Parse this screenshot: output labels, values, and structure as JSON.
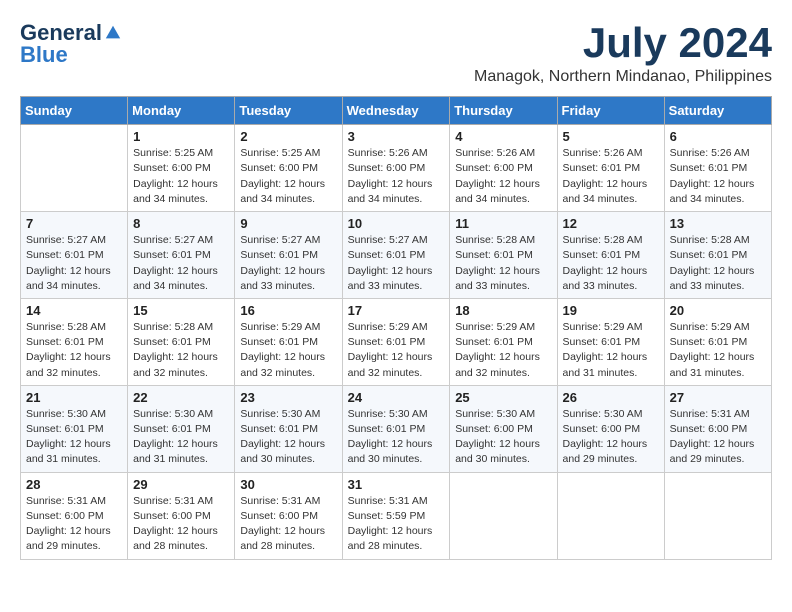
{
  "header": {
    "logo_general": "General",
    "logo_blue": "Blue",
    "month_year": "July 2024",
    "location": "Managok, Northern Mindanao, Philippines"
  },
  "days_of_week": [
    "Sunday",
    "Monday",
    "Tuesday",
    "Wednesday",
    "Thursday",
    "Friday",
    "Saturday"
  ],
  "weeks": [
    [
      {
        "day": "",
        "info": ""
      },
      {
        "day": "1",
        "info": "Sunrise: 5:25 AM\nSunset: 6:00 PM\nDaylight: 12 hours\nand 34 minutes."
      },
      {
        "day": "2",
        "info": "Sunrise: 5:25 AM\nSunset: 6:00 PM\nDaylight: 12 hours\nand 34 minutes."
      },
      {
        "day": "3",
        "info": "Sunrise: 5:26 AM\nSunset: 6:00 PM\nDaylight: 12 hours\nand 34 minutes."
      },
      {
        "day": "4",
        "info": "Sunrise: 5:26 AM\nSunset: 6:00 PM\nDaylight: 12 hours\nand 34 minutes."
      },
      {
        "day": "5",
        "info": "Sunrise: 5:26 AM\nSunset: 6:01 PM\nDaylight: 12 hours\nand 34 minutes."
      },
      {
        "day": "6",
        "info": "Sunrise: 5:26 AM\nSunset: 6:01 PM\nDaylight: 12 hours\nand 34 minutes."
      }
    ],
    [
      {
        "day": "7",
        "info": "Sunrise: 5:27 AM\nSunset: 6:01 PM\nDaylight: 12 hours\nand 34 minutes."
      },
      {
        "day": "8",
        "info": "Sunrise: 5:27 AM\nSunset: 6:01 PM\nDaylight: 12 hours\nand 34 minutes."
      },
      {
        "day": "9",
        "info": "Sunrise: 5:27 AM\nSunset: 6:01 PM\nDaylight: 12 hours\nand 33 minutes."
      },
      {
        "day": "10",
        "info": "Sunrise: 5:27 AM\nSunset: 6:01 PM\nDaylight: 12 hours\nand 33 minutes."
      },
      {
        "day": "11",
        "info": "Sunrise: 5:28 AM\nSunset: 6:01 PM\nDaylight: 12 hours\nand 33 minutes."
      },
      {
        "day": "12",
        "info": "Sunrise: 5:28 AM\nSunset: 6:01 PM\nDaylight: 12 hours\nand 33 minutes."
      },
      {
        "day": "13",
        "info": "Sunrise: 5:28 AM\nSunset: 6:01 PM\nDaylight: 12 hours\nand 33 minutes."
      }
    ],
    [
      {
        "day": "14",
        "info": "Sunrise: 5:28 AM\nSunset: 6:01 PM\nDaylight: 12 hours\nand 32 minutes."
      },
      {
        "day": "15",
        "info": "Sunrise: 5:28 AM\nSunset: 6:01 PM\nDaylight: 12 hours\nand 32 minutes."
      },
      {
        "day": "16",
        "info": "Sunrise: 5:29 AM\nSunset: 6:01 PM\nDaylight: 12 hours\nand 32 minutes."
      },
      {
        "day": "17",
        "info": "Sunrise: 5:29 AM\nSunset: 6:01 PM\nDaylight: 12 hours\nand 32 minutes."
      },
      {
        "day": "18",
        "info": "Sunrise: 5:29 AM\nSunset: 6:01 PM\nDaylight: 12 hours\nand 32 minutes."
      },
      {
        "day": "19",
        "info": "Sunrise: 5:29 AM\nSunset: 6:01 PM\nDaylight: 12 hours\nand 31 minutes."
      },
      {
        "day": "20",
        "info": "Sunrise: 5:29 AM\nSunset: 6:01 PM\nDaylight: 12 hours\nand 31 minutes."
      }
    ],
    [
      {
        "day": "21",
        "info": "Sunrise: 5:30 AM\nSunset: 6:01 PM\nDaylight: 12 hours\nand 31 minutes."
      },
      {
        "day": "22",
        "info": "Sunrise: 5:30 AM\nSunset: 6:01 PM\nDaylight: 12 hours\nand 31 minutes."
      },
      {
        "day": "23",
        "info": "Sunrise: 5:30 AM\nSunset: 6:01 PM\nDaylight: 12 hours\nand 30 minutes."
      },
      {
        "day": "24",
        "info": "Sunrise: 5:30 AM\nSunset: 6:01 PM\nDaylight: 12 hours\nand 30 minutes."
      },
      {
        "day": "25",
        "info": "Sunrise: 5:30 AM\nSunset: 6:00 PM\nDaylight: 12 hours\nand 30 minutes."
      },
      {
        "day": "26",
        "info": "Sunrise: 5:30 AM\nSunset: 6:00 PM\nDaylight: 12 hours\nand 29 minutes."
      },
      {
        "day": "27",
        "info": "Sunrise: 5:31 AM\nSunset: 6:00 PM\nDaylight: 12 hours\nand 29 minutes."
      }
    ],
    [
      {
        "day": "28",
        "info": "Sunrise: 5:31 AM\nSunset: 6:00 PM\nDaylight: 12 hours\nand 29 minutes."
      },
      {
        "day": "29",
        "info": "Sunrise: 5:31 AM\nSunset: 6:00 PM\nDaylight: 12 hours\nand 28 minutes."
      },
      {
        "day": "30",
        "info": "Sunrise: 5:31 AM\nSunset: 6:00 PM\nDaylight: 12 hours\nand 28 minutes."
      },
      {
        "day": "31",
        "info": "Sunrise: 5:31 AM\nSunset: 5:59 PM\nDaylight: 12 hours\nand 28 minutes."
      },
      {
        "day": "",
        "info": ""
      },
      {
        "day": "",
        "info": ""
      },
      {
        "day": "",
        "info": ""
      }
    ]
  ]
}
